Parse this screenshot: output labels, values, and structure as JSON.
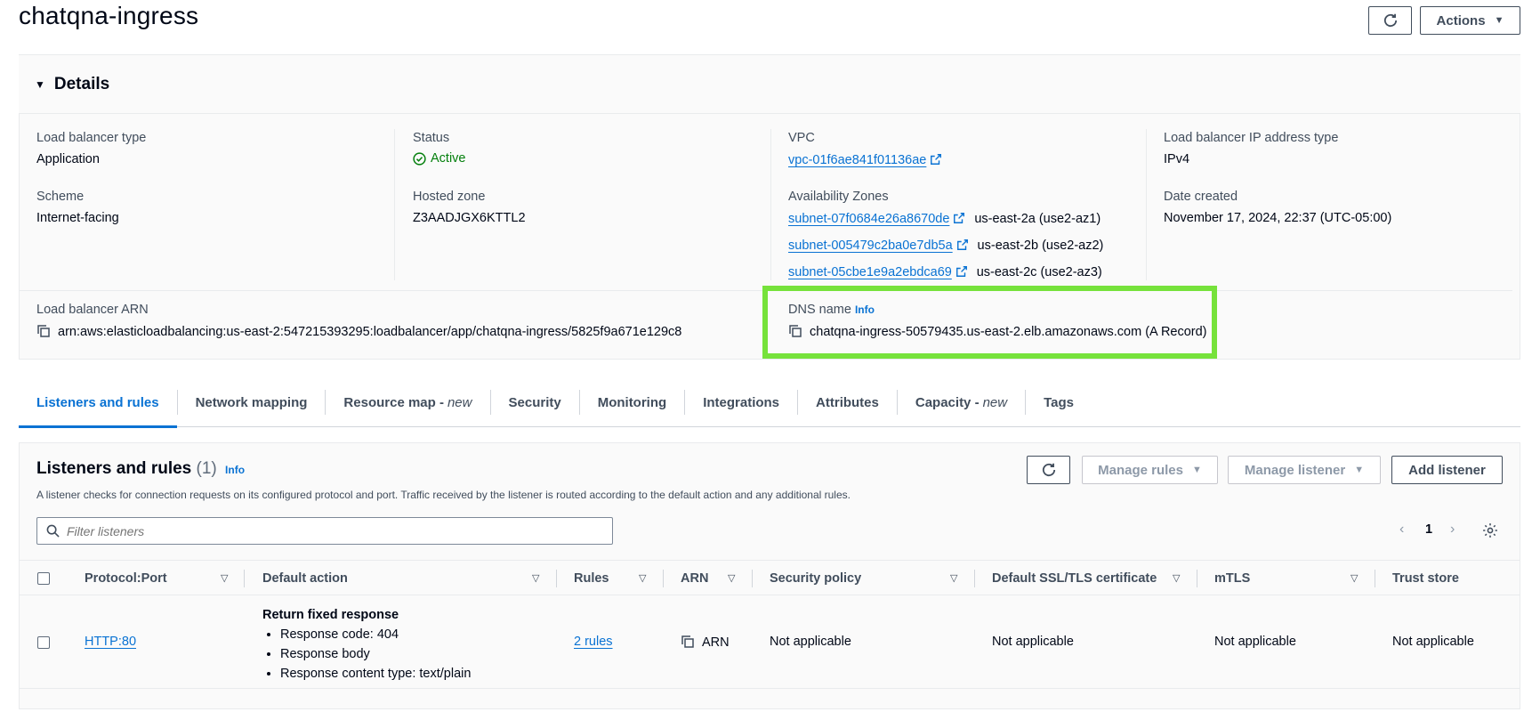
{
  "header": {
    "title": "chatqna-ingress",
    "actions_label": "Actions"
  },
  "details": {
    "title": "Details",
    "load_balancer_type": {
      "label": "Load balancer type",
      "value": "Application"
    },
    "scheme": {
      "label": "Scheme",
      "value": "Internet-facing"
    },
    "status": {
      "label": "Status",
      "value": "Active"
    },
    "hosted_zone": {
      "label": "Hosted zone",
      "value": "Z3AADJGX6KTTL2"
    },
    "vpc": {
      "label": "VPC",
      "value": "vpc-01f6ae841f01136ae"
    },
    "availability_zones": {
      "label": "Availability Zones",
      "items": [
        {
          "subnet": "subnet-07f0684e26a8670de",
          "zone": "us-east-2a (use2-az1)"
        },
        {
          "subnet": "subnet-005479c2ba0e7db5a",
          "zone": "us-east-2b (use2-az2)"
        },
        {
          "subnet": "subnet-05cbe1e9a2ebdca69",
          "zone": "us-east-2c (use2-az3)"
        }
      ]
    },
    "ip_address_type": {
      "label": "Load balancer IP address type",
      "value": "IPv4"
    },
    "date_created": {
      "label": "Date created",
      "value": "November 17, 2024, 22:37 (UTC-05:00)"
    },
    "arn": {
      "label": "Load balancer ARN",
      "value": "arn:aws:elasticloadbalancing:us-east-2:547215393295:loadbalancer/app/chatqna-ingress/5825f9a671e129c8"
    },
    "dns_name": {
      "label": "DNS name",
      "info": "Info",
      "value": "chatqna-ingress-50579435.us-east-2.elb.amazonaws.com (A Record)"
    }
  },
  "tabs": [
    {
      "label": "Listeners and rules",
      "suffix": ""
    },
    {
      "label": "Network mapping",
      "suffix": ""
    },
    {
      "label": "Resource map -",
      "suffix": "new"
    },
    {
      "label": "Security",
      "suffix": ""
    },
    {
      "label": "Monitoring",
      "suffix": ""
    },
    {
      "label": "Integrations",
      "suffix": ""
    },
    {
      "label": "Attributes",
      "suffix": ""
    },
    {
      "label": "Capacity -",
      "suffix": "new"
    },
    {
      "label": "Tags",
      "suffix": ""
    }
  ],
  "listeners": {
    "title": "Listeners and rules",
    "count": "(1)",
    "info": "Info",
    "description": "A listener checks for connection requests on its configured protocol and port. Traffic received by the listener is routed according to the default action and any additional rules.",
    "manage_rules_label": "Manage rules",
    "manage_listener_label": "Manage listener",
    "add_listener_label": "Add listener",
    "filter_placeholder": "Filter listeners",
    "page_number": "1",
    "columns": [
      "Protocol:Port",
      "Default action",
      "Rules",
      "ARN",
      "Security policy",
      "Default SSL/TLS certificate",
      "mTLS",
      "Trust store"
    ],
    "row": {
      "protocol_port": "HTTP:80",
      "default_action_title": "Return fixed response",
      "default_action_items": [
        "Response code: 404",
        "Response body",
        "Response content type: text/plain"
      ],
      "rules": "2 rules",
      "arn": "ARN",
      "security_policy": "Not applicable",
      "ssl_certificate": "Not applicable",
      "mtls": "Not applicable",
      "trust_store": "Not applicable"
    }
  },
  "colors": {
    "link": "#0972d3",
    "active_status": "#037f0c",
    "highlight": "#76e23b"
  }
}
